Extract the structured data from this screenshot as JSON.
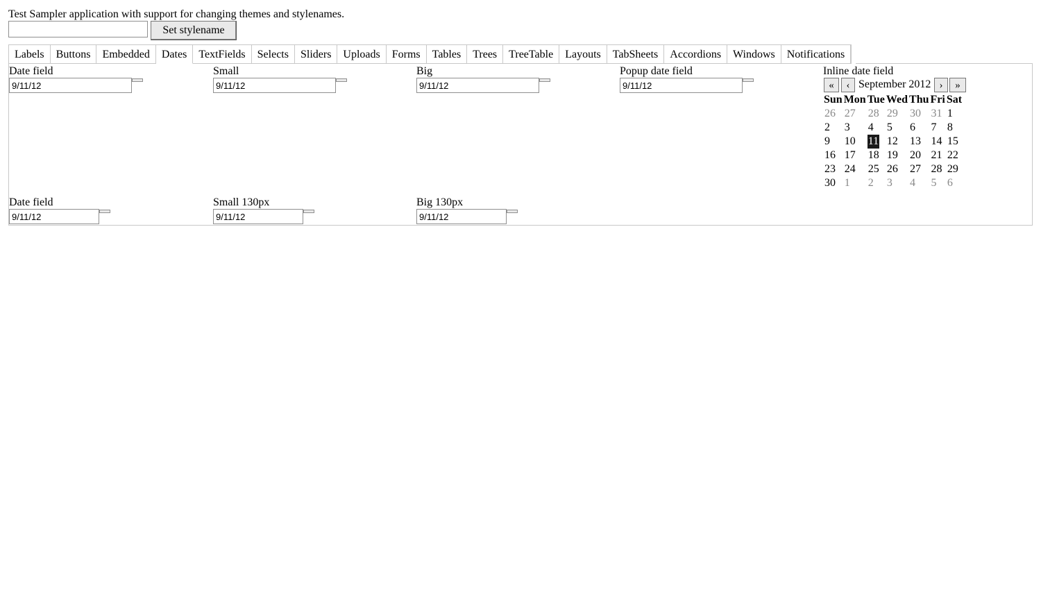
{
  "intro_text": "Test Sampler application with support for changing themes and stylenames.",
  "stylename": {
    "value": "",
    "button_label": "Set stylename"
  },
  "tabs": [
    "Labels",
    "Buttons",
    "Embedded",
    "Dates",
    "TextFields",
    "Selects",
    "Sliders",
    "Uploads",
    "Forms",
    "Tables",
    "Trees",
    "TreeTable",
    "Layouts",
    "TabSheets",
    "Accordions",
    "Windows",
    "Notifications"
  ],
  "selected_tab": "Dates",
  "row1": [
    {
      "caption": "Date field",
      "value": "9/11/12"
    },
    {
      "caption": "Small",
      "value": "9/11/12"
    },
    {
      "caption": "Big",
      "value": "9/11/12"
    },
    {
      "caption": "Popup date field",
      "value": "9/11/12"
    }
  ],
  "row2": [
    {
      "caption": "Date field",
      "value": "9/11/12"
    },
    {
      "caption": "Small 130px",
      "value": "9/11/12"
    },
    {
      "caption": "Big 130px",
      "value": "9/11/12"
    }
  ],
  "inline": {
    "caption": "Inline date field",
    "month": "September 2012",
    "nav": {
      "prev_year": "«",
      "prev_month": "‹",
      "next_month": "›",
      "next_year": "»"
    },
    "weekdays": [
      "Sun",
      "Mon",
      "Tue",
      "Wed",
      "Thu",
      "Fri",
      "Sat"
    ],
    "weeks": [
      [
        {
          "d": "26",
          "o": true
        },
        {
          "d": "27",
          "o": true
        },
        {
          "d": "28",
          "o": true
        },
        {
          "d": "29",
          "o": true
        },
        {
          "d": "30",
          "o": true
        },
        {
          "d": "31",
          "o": true
        },
        {
          "d": "1"
        }
      ],
      [
        {
          "d": "2"
        },
        {
          "d": "3"
        },
        {
          "d": "4"
        },
        {
          "d": "5"
        },
        {
          "d": "6"
        },
        {
          "d": "7"
        },
        {
          "d": "8"
        }
      ],
      [
        {
          "d": "9"
        },
        {
          "d": "10"
        },
        {
          "d": "11",
          "s": true
        },
        {
          "d": "12"
        },
        {
          "d": "13"
        },
        {
          "d": "14"
        },
        {
          "d": "15"
        }
      ],
      [
        {
          "d": "16"
        },
        {
          "d": "17"
        },
        {
          "d": "18"
        },
        {
          "d": "19"
        },
        {
          "d": "20"
        },
        {
          "d": "21"
        },
        {
          "d": "22"
        }
      ],
      [
        {
          "d": "23"
        },
        {
          "d": "24"
        },
        {
          "d": "25"
        },
        {
          "d": "26"
        },
        {
          "d": "27"
        },
        {
          "d": "28"
        },
        {
          "d": "29"
        }
      ],
      [
        {
          "d": "30"
        },
        {
          "d": "1",
          "o": true
        },
        {
          "d": "2",
          "o": true
        },
        {
          "d": "3",
          "o": true
        },
        {
          "d": "4",
          "o": true
        },
        {
          "d": "5",
          "o": true
        },
        {
          "d": "6",
          "o": true
        }
      ]
    ]
  }
}
